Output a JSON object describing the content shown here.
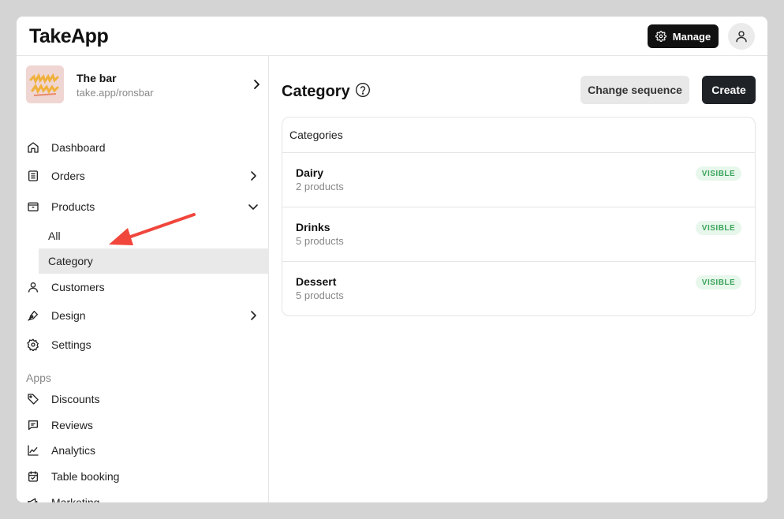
{
  "app": {
    "logo_text": "TakeApp"
  },
  "header": {
    "manage_label": "Manage"
  },
  "store": {
    "name": "The bar",
    "url": "take.app/ronsbar"
  },
  "sidebar": {
    "items": [
      {
        "label": "Dashboard"
      },
      {
        "label": "Orders"
      },
      {
        "label": "Products"
      },
      {
        "label": "All"
      },
      {
        "label": "Category"
      },
      {
        "label": "Customers"
      },
      {
        "label": "Design"
      },
      {
        "label": "Settings"
      }
    ],
    "apps_section_label": "Apps",
    "apps": [
      {
        "label": "Discounts"
      },
      {
        "label": "Reviews"
      },
      {
        "label": "Analytics"
      },
      {
        "label": "Table booking"
      },
      {
        "label": "Marketing"
      }
    ]
  },
  "main": {
    "title": "Category",
    "change_sequence_label": "Change sequence",
    "create_label": "Create",
    "card_title": "Categories",
    "categories": [
      {
        "name": "Dairy",
        "count": "2 products",
        "status": "VISIBLE"
      },
      {
        "name": "Drinks",
        "count": "5 products",
        "status": "VISIBLE"
      },
      {
        "name": "Dessert",
        "count": "5 products",
        "status": "VISIBLE"
      }
    ]
  },
  "colors": {
    "accent": "#111111",
    "badge_text": "#3ba55c",
    "badge_bg": "#e8f7ec",
    "annotation_arrow": "#f0463c",
    "active_item_bg": "#e9e9e9"
  }
}
